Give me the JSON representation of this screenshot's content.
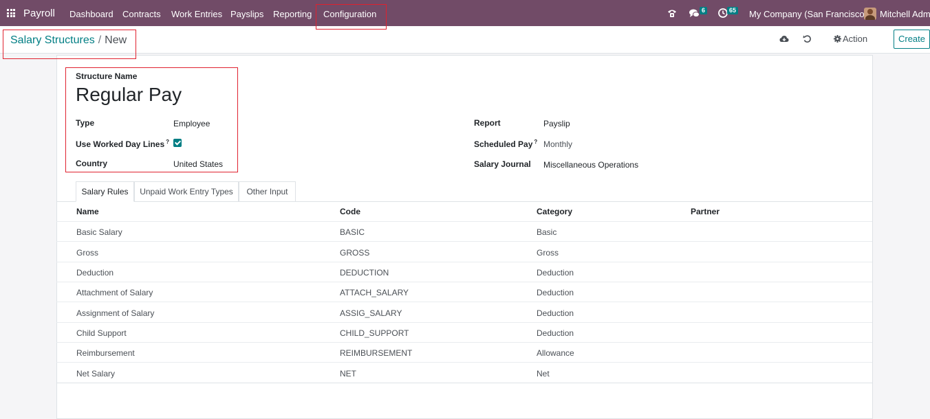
{
  "navbar": {
    "app_name": "Payroll",
    "menu": [
      "Dashboard",
      "Contracts",
      "Work Entries",
      "Payslips",
      "Reporting",
      "Configuration"
    ],
    "messages_count": "6",
    "activities_count": "65",
    "company": "My Company (San Francisco)",
    "user": "Mitchell Admin",
    "colors": {
      "bar": "#714b67",
      "badge": "#017e84"
    }
  },
  "breadcrumb": {
    "parent": "Salary Structures",
    "separator": "/",
    "current": "New"
  },
  "control_panel": {
    "action_label": "Action",
    "create_label": "Create"
  },
  "form": {
    "structure_name_label": "Structure Name",
    "structure_name": "Regular Pay",
    "type_label": "Type",
    "type_value": "Employee",
    "use_worked_day_lines_label": "Use Worked Day Lines",
    "use_worked_day_lines": true,
    "country_label": "Country",
    "country_value": "United States",
    "report_label": "Report",
    "report_value": "Payslip",
    "scheduled_pay_label": "Scheduled Pay",
    "scheduled_pay_value": "Monthly",
    "salary_journal_label": "Salary Journal",
    "salary_journal_value": "Miscellaneous Operations",
    "help_mark": "?"
  },
  "tabs": [
    "Salary Rules",
    "Unpaid Work Entry Types",
    "Other Input"
  ],
  "table": {
    "columns": [
      "Name",
      "Code",
      "Category",
      "Partner"
    ],
    "rows": [
      [
        "Basic Salary",
        "BASIC",
        "Basic",
        ""
      ],
      [
        "Gross",
        "GROSS",
        "Gross",
        ""
      ],
      [
        "Deduction",
        "DEDUCTION",
        "Deduction",
        ""
      ],
      [
        "Attachment of Salary",
        "ATTACH_SALARY",
        "Deduction",
        ""
      ],
      [
        "Assignment of Salary",
        "ASSIG_SALARY",
        "Deduction",
        ""
      ],
      [
        "Child Support",
        "CHILD_SUPPORT",
        "Deduction",
        ""
      ],
      [
        "Reimbursement",
        "REIMBURSEMENT",
        "Allowance",
        ""
      ],
      [
        "Net Salary",
        "NET",
        "Net",
        ""
      ]
    ]
  }
}
